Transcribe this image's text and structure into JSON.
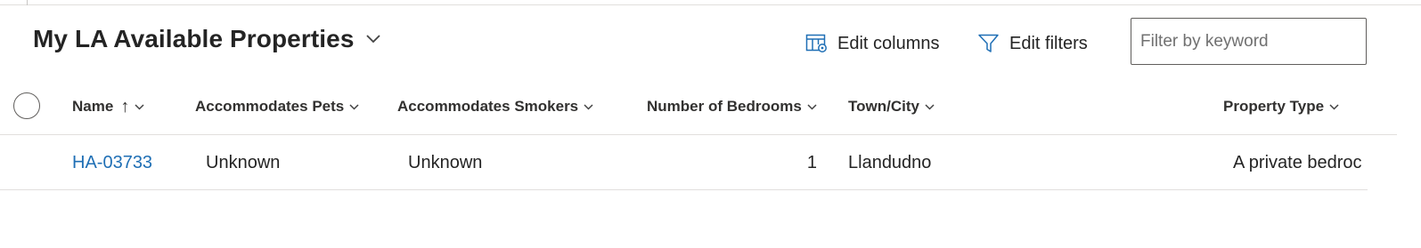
{
  "view": {
    "title": "My LA Available Properties"
  },
  "commands": {
    "edit_columns_label": "Edit columns",
    "edit_filters_label": "Edit filters"
  },
  "filter": {
    "placeholder": "Filter by keyword",
    "value": ""
  },
  "grid": {
    "columns": [
      {
        "label": "Name",
        "sort": "ascending"
      },
      {
        "label": "Accommodates Pets"
      },
      {
        "label": "Accommodates Smokers"
      },
      {
        "label": "Number of Bedrooms"
      },
      {
        "label": "Town/City"
      },
      {
        "label": "Property Type"
      }
    ],
    "sort_arrow": "↑",
    "rows": [
      {
        "name": "HA-03733",
        "pets": "Unknown",
        "smokers": "Unknown",
        "bedrooms": "1",
        "town": "Llandudno",
        "property_type": "A private bedroc"
      }
    ]
  },
  "icons": {
    "title_chevron": "chevron-down-icon",
    "edit_columns": "edit-columns-icon",
    "edit_filters": "funnel-icon",
    "select_all": "circle-checkbox-icon",
    "column_chevron": "chevron-down-icon"
  },
  "colors": {
    "link": "#1f6fb5",
    "accent_icon": "#1f6fb5",
    "border": "#e1dfdd",
    "text": "#242424"
  }
}
